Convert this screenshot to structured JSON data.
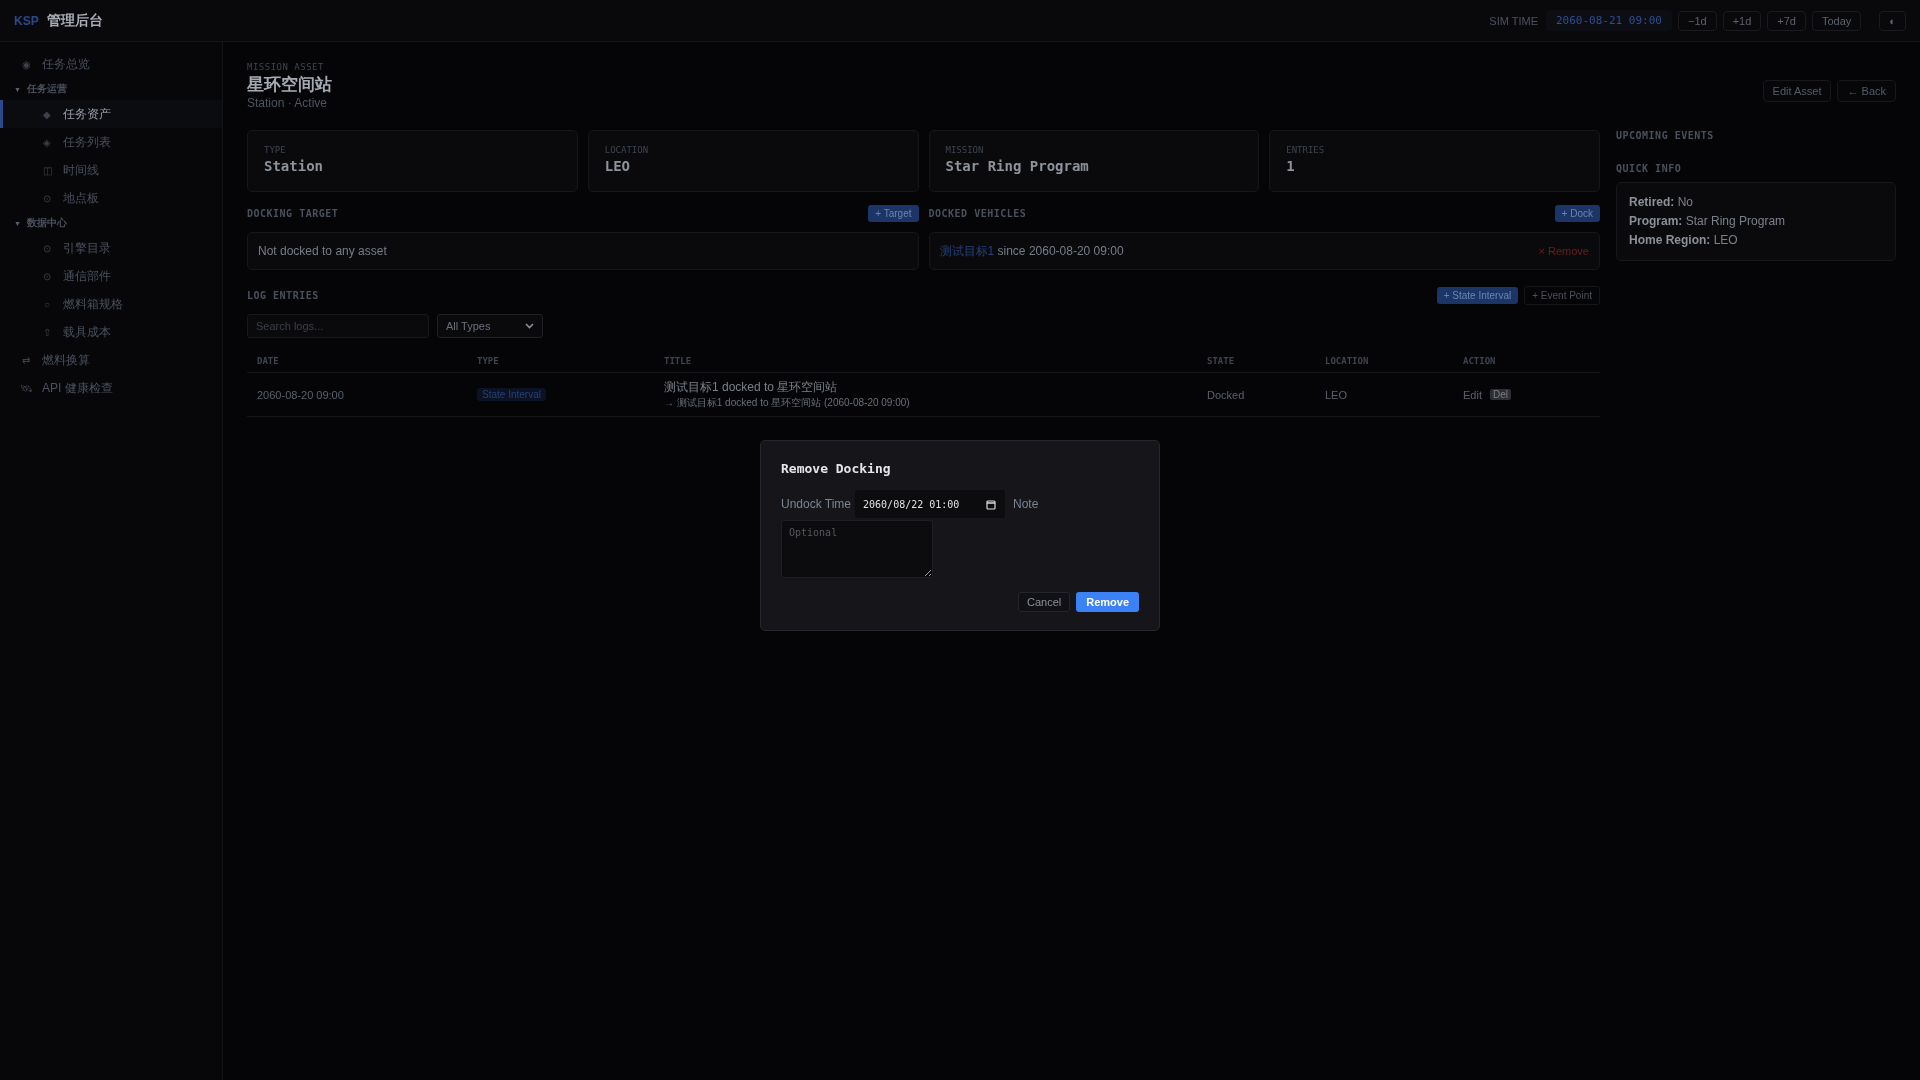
{
  "brand": {
    "logo": "KSP",
    "title": "管理后台"
  },
  "topbar": {
    "sim_label": "SIM TIME",
    "sim_time": "2060-08-21 09:00",
    "buttons": [
      "−1d",
      "+1d",
      "+7d",
      "Today"
    ],
    "theme_button": "◐"
  },
  "sidebar": {
    "items": [
      {
        "kind": "link",
        "icon": "◉",
        "label": "任务总览",
        "selected": false
      },
      {
        "kind": "group",
        "caret": "▼",
        "label": "任务运营",
        "expanded": true,
        "children": [
          {
            "kind": "link",
            "icon": "◆",
            "label": "任务资产",
            "selected": true
          },
          {
            "kind": "link",
            "icon": "◈",
            "label": "任务列表",
            "selected": false
          },
          {
            "kind": "link",
            "icon": "◫",
            "label": "时间线",
            "selected": false
          },
          {
            "kind": "link",
            "icon": "⊙",
            "label": "地点板",
            "selected": false
          }
        ]
      },
      {
        "kind": "group",
        "caret": "▼",
        "label": "数据中心",
        "expanded": true,
        "children": [
          {
            "kind": "link",
            "icon": "⊙",
            "label": "引擎目录",
            "selected": false
          },
          {
            "kind": "link",
            "icon": "⊙",
            "label": "通信部件",
            "selected": false
          },
          {
            "kind": "link",
            "icon": "○",
            "label": "燃料箱规格",
            "selected": false
          },
          {
            "kind": "link",
            "icon": "⇧",
            "label": "载具成本",
            "selected": false
          }
        ]
      },
      {
        "kind": "link",
        "icon": "⇄",
        "label": "燃料换算",
        "selected": false
      },
      {
        "kind": "link",
        "icon": "🛰",
        "label": "API 健康检查",
        "selected": false
      }
    ]
  },
  "header": {
    "eyebrow": "MISSION ASSET",
    "title": "星环空间站",
    "subtitle": "Station · Active",
    "actions": [
      "Edit Asset",
      "← Back"
    ]
  },
  "stats": [
    {
      "label": "TYPE",
      "value": "Station"
    },
    {
      "label": "LOCATION",
      "value": "LEO"
    },
    {
      "label": "MISSION",
      "value": "Star Ring Program"
    },
    {
      "label": "ENTRIES",
      "value": "1"
    }
  ],
  "docking_target": {
    "title": "DOCKING TARGET",
    "button": "+ Target",
    "empty": "Not docked to any asset"
  },
  "docked_vehicles": {
    "title": "DOCKED VEHICLES",
    "button": "+ Dock",
    "items": [
      {
        "name": "测试目标1",
        "since": "since 2060-08-20 09:00",
        "remove": "× Remove"
      }
    ]
  },
  "log": {
    "title": "LOG ENTRIES",
    "buttons": [
      "+ State Interval",
      "+ Event Point"
    ],
    "search": {
      "placeholder": "Search logs..."
    },
    "filter": "All Types",
    "columns": [
      "DATE",
      "TYPE",
      "TITLE",
      "STATE",
      "LOCATION",
      "ACTION"
    ],
    "rows": [
      {
        "date": "2060-08-20 09:00",
        "type": "State Interval",
        "title": "测试目标1 docked to 星环空间站",
        "detail": "→ 测试目标1 docked to 星环空间站 (2060-08-20 09:00)",
        "state": "Docked",
        "location": "LEO",
        "actions": [
          "Edit",
          "Del"
        ]
      }
    ]
  },
  "right": {
    "upcoming_title": "UPCOMING EVENTS",
    "quick_info_title": "QUICK INFO",
    "quick_info": [
      {
        "label": "Retired:",
        "value": "No"
      },
      {
        "label": "Program:",
        "value": "Star Ring Program"
      },
      {
        "label": "Home Region:",
        "value": "LEO"
      }
    ]
  },
  "modal": {
    "title": "Remove Docking",
    "undock_label": "Undock Time",
    "undock_value": "2060/08/22 01:00",
    "note_label": "Note",
    "note_placeholder": "Optional",
    "cancel": "Cancel",
    "confirm": "Remove"
  }
}
